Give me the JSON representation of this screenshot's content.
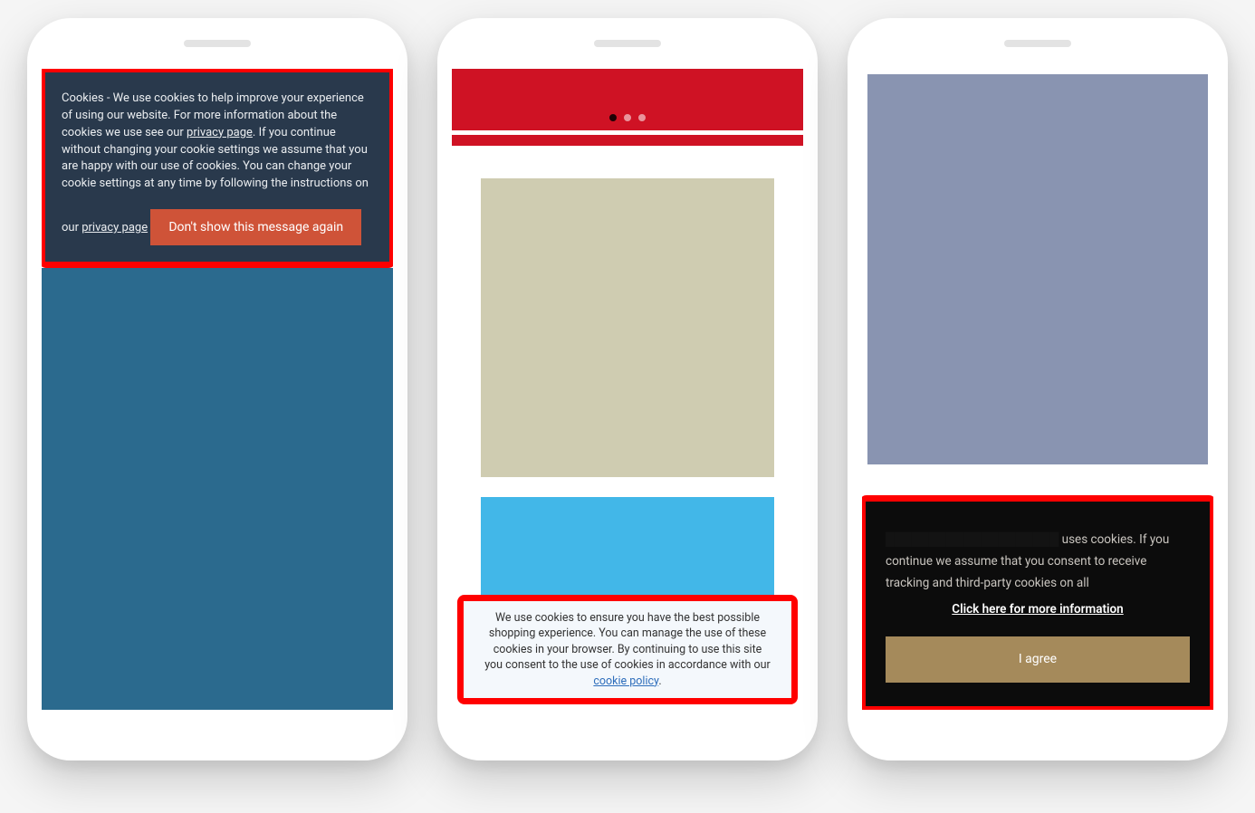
{
  "phone1": {
    "banner_text_pre": "Cookies - We use cookies to help improve your experience of using our website. For more information about the cookies we use see our ",
    "privacy_link_1": "privacy page",
    "banner_text_mid": ". If you continue without changing your cookie settings we assume that you are happy with our use of cookies. You can change your cookie settings at any time by following the instructions on our ",
    "privacy_link_2": "privacy page",
    "button_label": "Don't show this message again"
  },
  "phone2": {
    "banner_text_pre": "We use cookies to ensure you have the best possible shopping experience. You can manage the use of these cookies in your browser. By continuing to use this site you consent to the use of cookies in accordance with our ",
    "policy_link": "cookie policy"
  },
  "phone3": {
    "banner_text": " uses cookies. If you continue we assume that you consent to receive tracking and third-party cookies on all ",
    "info_link": "Click here for more information",
    "button_label": "I agree"
  }
}
